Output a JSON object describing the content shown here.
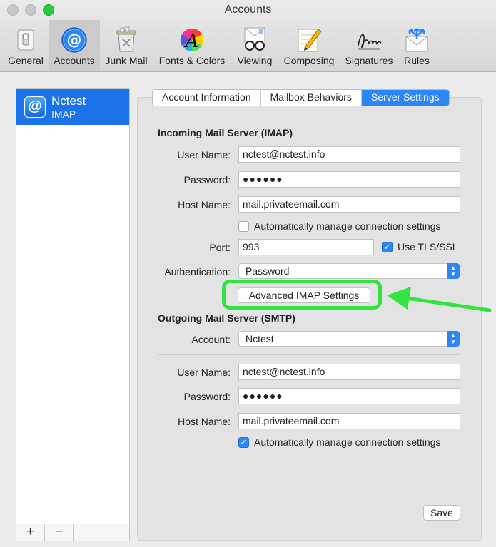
{
  "window": {
    "title": "Accounts",
    "accent_color": "#2c86f5",
    "annotation_color": "#33e33f"
  },
  "toolbar": {
    "items": [
      {
        "label": "General",
        "icon": "switch-icon"
      },
      {
        "label": "Accounts",
        "icon": "at-sign-icon",
        "selected": true
      },
      {
        "label": "Junk Mail",
        "icon": "trash-icon"
      },
      {
        "label": "Fonts & Colors",
        "icon": "color-wheel-font-icon"
      },
      {
        "label": "Viewing",
        "icon": "glasses-icon"
      },
      {
        "label": "Composing",
        "icon": "pencil-paper-icon"
      },
      {
        "label": "Signatures",
        "icon": "signature-icon"
      },
      {
        "label": "Rules",
        "icon": "envelope-arrows-icon"
      }
    ]
  },
  "accounts": {
    "items": [
      {
        "name": "Nctest",
        "type": "IMAP"
      }
    ],
    "add_label": "+",
    "remove_label": "−"
  },
  "tabs": [
    {
      "label": "Account Information"
    },
    {
      "label": "Mailbox Behaviors"
    },
    {
      "label": "Server Settings",
      "active": true
    }
  ],
  "incoming": {
    "title": "Incoming Mail Server (IMAP)",
    "username_label": "User Name:",
    "username": "nctest@nctest.info",
    "password_label": "Password:",
    "password": "●●●●●●",
    "hostname_label": "Host Name:",
    "hostname": "mail.privateemail.com",
    "auto_manage_label": "Automatically manage connection settings",
    "auto_manage_checked": false,
    "port_label": "Port:",
    "port": "993",
    "tls_label": "Use TLS/SSL",
    "tls_checked": true,
    "auth_label": "Authentication:",
    "auth_value": "Password",
    "advanced_button": "Advanced IMAP Settings"
  },
  "outgoing": {
    "title": "Outgoing Mail Server (SMTP)",
    "account_label": "Account:",
    "account_value": "Nctest",
    "username_label": "User Name:",
    "username": "nctest@nctest.info",
    "password_label": "Password:",
    "password": "●●●●●●",
    "hostname_label": "Host Name:",
    "hostname": "mail.privateemail.com",
    "auto_manage_label": "Automatically manage connection settings",
    "auto_manage_checked": true
  },
  "footer": {
    "save_label": "Save"
  }
}
